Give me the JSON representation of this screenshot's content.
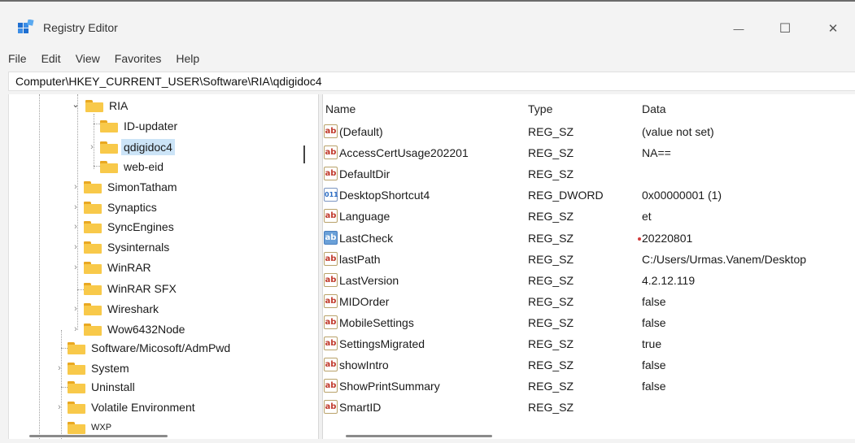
{
  "window": {
    "title": "Registry Editor",
    "controls": {
      "minimize": "—",
      "maximize": "☐",
      "close": "✕"
    }
  },
  "menu": [
    "File",
    "Edit",
    "View",
    "Favorites",
    "Help"
  ],
  "address": "Computer\\HKEY_CURRENT_USER\\Software\\RIA\\qdigidoc4",
  "tree": {
    "items": [
      {
        "label": "RIA",
        "expander": "expanded"
      },
      {
        "label": "ID-updater",
        "expander": "none"
      },
      {
        "label": "qdigidoc4",
        "expander": "collapsed",
        "selected": true
      },
      {
        "label": "web-eid",
        "expander": "none"
      },
      {
        "label": "SimonTatham",
        "expander": "collapsed"
      },
      {
        "label": "Synaptics",
        "expander": "collapsed"
      },
      {
        "label": "SyncEngines",
        "expander": "collapsed"
      },
      {
        "label": "Sysinternals",
        "expander": "collapsed"
      },
      {
        "label": "WinRAR",
        "expander": "collapsed"
      },
      {
        "label": "WinRAR SFX",
        "expander": "none"
      },
      {
        "label": "Wireshark",
        "expander": "collapsed"
      },
      {
        "label": "Wow6432Node",
        "expander": "collapsed"
      },
      {
        "label": "Software/Micosoft/AdmPwd",
        "expander": "none"
      },
      {
        "label": "System",
        "expander": "collapsed"
      },
      {
        "label": "Uninstall",
        "expander": "none"
      },
      {
        "label": "Volatile Environment",
        "expander": "collapsed"
      },
      {
        "label": "WXP",
        "expander": "none"
      }
    ]
  },
  "list": {
    "columns": [
      "Name",
      "Type",
      "Data"
    ],
    "rows": [
      {
        "icon": "ab",
        "name": "(Default)",
        "type": "REG_SZ",
        "data": "(value not set)"
      },
      {
        "icon": "ab",
        "name": "AccessCertUsage202201",
        "type": "REG_SZ",
        "data": "NA=="
      },
      {
        "icon": "ab",
        "name": "DefaultDir",
        "type": "REG_SZ",
        "data": ""
      },
      {
        "icon": "bin",
        "name": "DesktopShortcut4",
        "type": "REG_DWORD",
        "data": "0x00000001 (1)"
      },
      {
        "icon": "ab",
        "name": "Language",
        "type": "REG_SZ",
        "data": "et"
      },
      {
        "icon": "ab-selected",
        "name": "LastCheck",
        "type": "REG_SZ",
        "data": "20220801"
      },
      {
        "icon": "ab",
        "name": "lastPath",
        "type": "REG_SZ",
        "data": "C:/Users/Urmas.Vanem/Desktop"
      },
      {
        "icon": "ab",
        "name": "LastVersion",
        "type": "REG_SZ",
        "data": "4.2.12.119"
      },
      {
        "icon": "ab",
        "name": "MIDOrder",
        "type": "REG_SZ",
        "data": "false"
      },
      {
        "icon": "ab",
        "name": "MobileSettings",
        "type": "REG_SZ",
        "data": "false"
      },
      {
        "icon": "ab",
        "name": "SettingsMigrated",
        "type": "REG_SZ",
        "data": "true"
      },
      {
        "icon": "ab",
        "name": "showIntro",
        "type": "REG_SZ",
        "data": "false"
      },
      {
        "icon": "ab",
        "name": "ShowPrintSummary",
        "type": "REG_SZ",
        "data": "false"
      },
      {
        "icon": "ab",
        "name": "SmartID",
        "type": "REG_SZ",
        "data": ""
      }
    ]
  },
  "colors": {
    "folder": "#f8c94a",
    "selection": "#cce4f7",
    "accent_dot": "#d23b3b"
  }
}
